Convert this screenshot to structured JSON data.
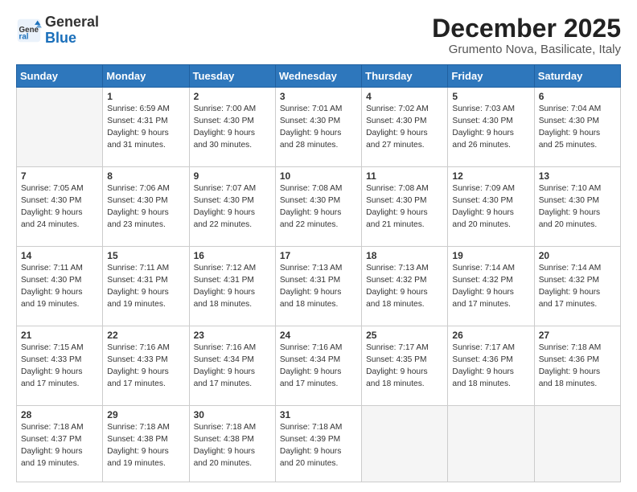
{
  "header": {
    "logo_general": "General",
    "logo_blue": "Blue",
    "month": "December 2025",
    "location": "Grumento Nova, Basilicate, Italy"
  },
  "weekdays": [
    "Sunday",
    "Monday",
    "Tuesday",
    "Wednesday",
    "Thursday",
    "Friday",
    "Saturday"
  ],
  "weeks": [
    [
      {
        "day": "",
        "content": ""
      },
      {
        "day": "1",
        "content": "Sunrise: 6:59 AM\nSunset: 4:31 PM\nDaylight: 9 hours\nand 31 minutes."
      },
      {
        "day": "2",
        "content": "Sunrise: 7:00 AM\nSunset: 4:30 PM\nDaylight: 9 hours\nand 30 minutes."
      },
      {
        "day": "3",
        "content": "Sunrise: 7:01 AM\nSunset: 4:30 PM\nDaylight: 9 hours\nand 28 minutes."
      },
      {
        "day": "4",
        "content": "Sunrise: 7:02 AM\nSunset: 4:30 PM\nDaylight: 9 hours\nand 27 minutes."
      },
      {
        "day": "5",
        "content": "Sunrise: 7:03 AM\nSunset: 4:30 PM\nDaylight: 9 hours\nand 26 minutes."
      },
      {
        "day": "6",
        "content": "Sunrise: 7:04 AM\nSunset: 4:30 PM\nDaylight: 9 hours\nand 25 minutes."
      }
    ],
    [
      {
        "day": "7",
        "content": "Sunrise: 7:05 AM\nSunset: 4:30 PM\nDaylight: 9 hours\nand 24 minutes."
      },
      {
        "day": "8",
        "content": "Sunrise: 7:06 AM\nSunset: 4:30 PM\nDaylight: 9 hours\nand 23 minutes."
      },
      {
        "day": "9",
        "content": "Sunrise: 7:07 AM\nSunset: 4:30 PM\nDaylight: 9 hours\nand 22 minutes."
      },
      {
        "day": "10",
        "content": "Sunrise: 7:08 AM\nSunset: 4:30 PM\nDaylight: 9 hours\nand 22 minutes."
      },
      {
        "day": "11",
        "content": "Sunrise: 7:08 AM\nSunset: 4:30 PM\nDaylight: 9 hours\nand 21 minutes."
      },
      {
        "day": "12",
        "content": "Sunrise: 7:09 AM\nSunset: 4:30 PM\nDaylight: 9 hours\nand 20 minutes."
      },
      {
        "day": "13",
        "content": "Sunrise: 7:10 AM\nSunset: 4:30 PM\nDaylight: 9 hours\nand 20 minutes."
      }
    ],
    [
      {
        "day": "14",
        "content": "Sunrise: 7:11 AM\nSunset: 4:30 PM\nDaylight: 9 hours\nand 19 minutes."
      },
      {
        "day": "15",
        "content": "Sunrise: 7:11 AM\nSunset: 4:31 PM\nDaylight: 9 hours\nand 19 minutes."
      },
      {
        "day": "16",
        "content": "Sunrise: 7:12 AM\nSunset: 4:31 PM\nDaylight: 9 hours\nand 18 minutes."
      },
      {
        "day": "17",
        "content": "Sunrise: 7:13 AM\nSunset: 4:31 PM\nDaylight: 9 hours\nand 18 minutes."
      },
      {
        "day": "18",
        "content": "Sunrise: 7:13 AM\nSunset: 4:32 PM\nDaylight: 9 hours\nand 18 minutes."
      },
      {
        "day": "19",
        "content": "Sunrise: 7:14 AM\nSunset: 4:32 PM\nDaylight: 9 hours\nand 17 minutes."
      },
      {
        "day": "20",
        "content": "Sunrise: 7:14 AM\nSunset: 4:32 PM\nDaylight: 9 hours\nand 17 minutes."
      }
    ],
    [
      {
        "day": "21",
        "content": "Sunrise: 7:15 AM\nSunset: 4:33 PM\nDaylight: 9 hours\nand 17 minutes."
      },
      {
        "day": "22",
        "content": "Sunrise: 7:16 AM\nSunset: 4:33 PM\nDaylight: 9 hours\nand 17 minutes."
      },
      {
        "day": "23",
        "content": "Sunrise: 7:16 AM\nSunset: 4:34 PM\nDaylight: 9 hours\nand 17 minutes."
      },
      {
        "day": "24",
        "content": "Sunrise: 7:16 AM\nSunset: 4:34 PM\nDaylight: 9 hours\nand 17 minutes."
      },
      {
        "day": "25",
        "content": "Sunrise: 7:17 AM\nSunset: 4:35 PM\nDaylight: 9 hours\nand 18 minutes."
      },
      {
        "day": "26",
        "content": "Sunrise: 7:17 AM\nSunset: 4:36 PM\nDaylight: 9 hours\nand 18 minutes."
      },
      {
        "day": "27",
        "content": "Sunrise: 7:18 AM\nSunset: 4:36 PM\nDaylight: 9 hours\nand 18 minutes."
      }
    ],
    [
      {
        "day": "28",
        "content": "Sunrise: 7:18 AM\nSunset: 4:37 PM\nDaylight: 9 hours\nand 19 minutes."
      },
      {
        "day": "29",
        "content": "Sunrise: 7:18 AM\nSunset: 4:38 PM\nDaylight: 9 hours\nand 19 minutes."
      },
      {
        "day": "30",
        "content": "Sunrise: 7:18 AM\nSunset: 4:38 PM\nDaylight: 9 hours\nand 20 minutes."
      },
      {
        "day": "31",
        "content": "Sunrise: 7:18 AM\nSunset: 4:39 PM\nDaylight: 9 hours\nand 20 minutes."
      },
      {
        "day": "",
        "content": ""
      },
      {
        "day": "",
        "content": ""
      },
      {
        "day": "",
        "content": ""
      }
    ]
  ]
}
